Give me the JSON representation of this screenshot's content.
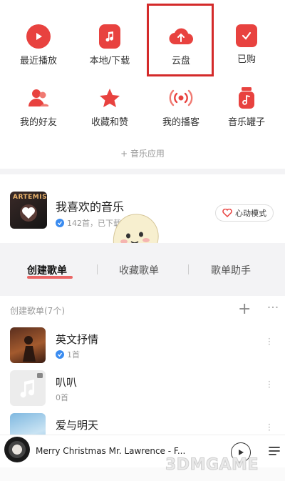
{
  "shortcuts": [
    {
      "label": "最近播放",
      "icon": "play-icon"
    },
    {
      "label": "本地/下载",
      "icon": "music-note-icon"
    },
    {
      "label": "云盘",
      "icon": "cloud-upload-icon"
    },
    {
      "label": "已购",
      "icon": "shopping-bag-icon"
    },
    {
      "label": "我的好友",
      "icon": "friends-icon"
    },
    {
      "label": "收藏和赞",
      "icon": "star-icon"
    },
    {
      "label": "我的播客",
      "icon": "broadcast-icon"
    },
    {
      "label": "音乐罐子",
      "icon": "music-jar-icon"
    }
  ],
  "music_apps": "+ 音乐应用",
  "favorites": {
    "title": "我喜欢的音乐",
    "subtitle": "142首，已下载2首",
    "mode_button": "心动模式",
    "cover_text": "ARTEMIS"
  },
  "tabs": {
    "created": "创建歌单",
    "collected": "收藏歌单",
    "assistant": "歌单助手"
  },
  "playlists_header": "创建歌单(7个)",
  "playlists": [
    {
      "name": "英文抒情",
      "count": "1首"
    },
    {
      "name": "叭叭",
      "count": "0首"
    },
    {
      "name": "爱与明天",
      "count": ""
    }
  ],
  "player": {
    "title": "Merry Christmas Mr. Lawrence - F..."
  },
  "watermark": "3DMGAME",
  "colors": {
    "accent": "#e8423f",
    "highlight_box": "#d42a2a",
    "verified": "#3b8cf0"
  }
}
